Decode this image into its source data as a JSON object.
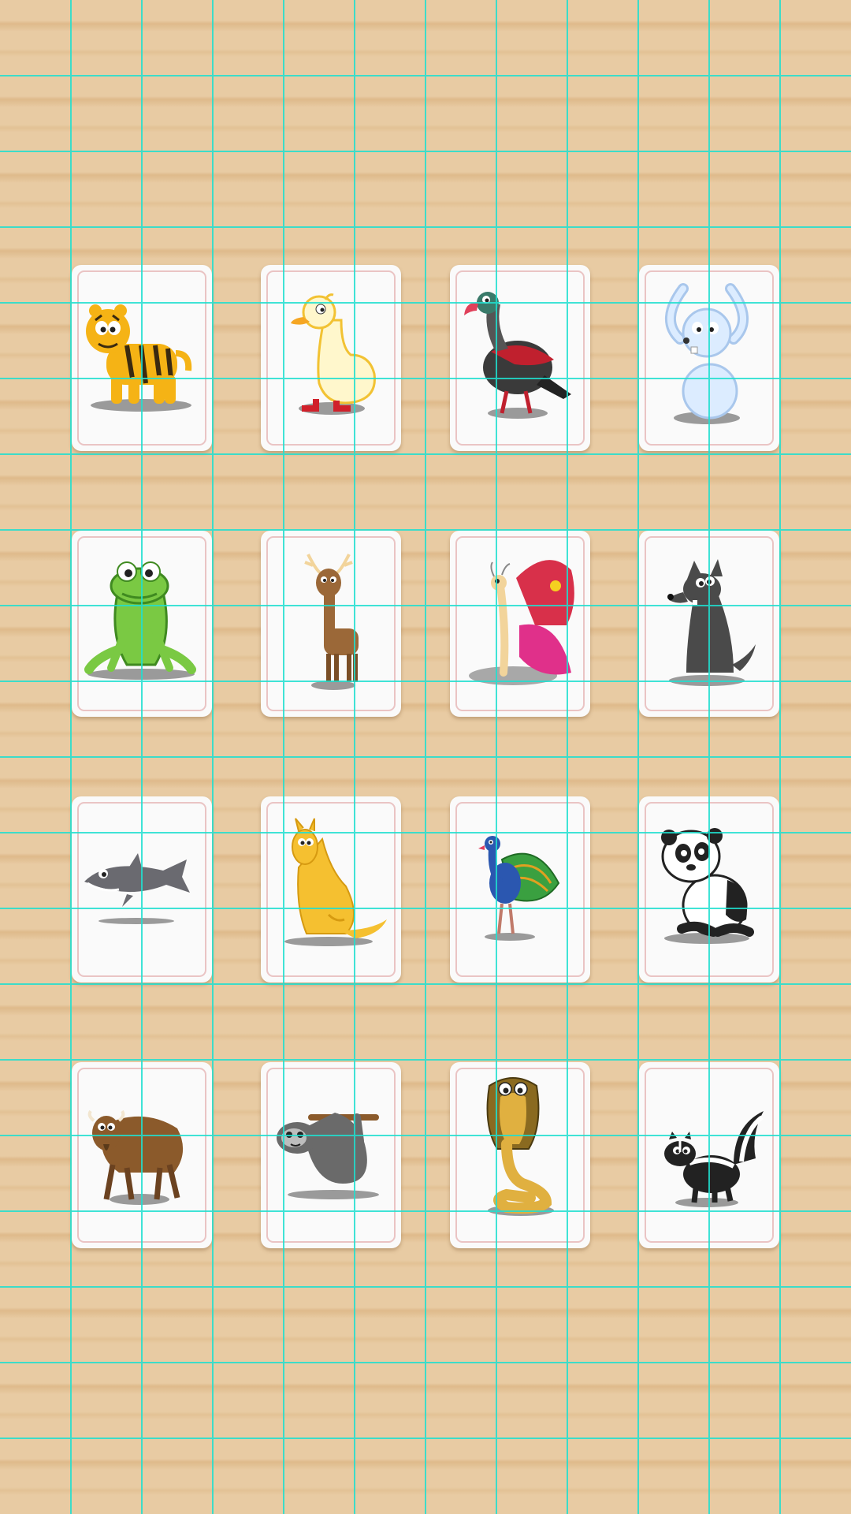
{
  "colors": {
    "table_wood": "#e8cba3",
    "wood_grain": "#d6ac78",
    "card_face": "#fafafa",
    "card_inner_border": "#eac4c4",
    "guide_lines": "#1fe0d0"
  },
  "cards": [
    {
      "animal": "tiger",
      "icon": "tiger-icon"
    },
    {
      "animal": "duck",
      "icon": "duck-icon"
    },
    {
      "animal": "vulture",
      "icon": "vulture-icon"
    },
    {
      "animal": "rabbit",
      "icon": "rabbit-icon"
    },
    {
      "animal": "frog",
      "icon": "frog-icon"
    },
    {
      "animal": "deer",
      "icon": "deer-icon"
    },
    {
      "animal": "butterfly",
      "icon": "butterfly-icon"
    },
    {
      "animal": "wolf",
      "icon": "wolf-icon"
    },
    {
      "animal": "shark",
      "icon": "shark-icon"
    },
    {
      "animal": "kangaroo",
      "icon": "kangaroo-icon"
    },
    {
      "animal": "peacock",
      "icon": "peacock-icon"
    },
    {
      "animal": "panda",
      "icon": "panda-icon"
    },
    {
      "animal": "wildebeest",
      "icon": "wildebeest-icon"
    },
    {
      "animal": "sloth",
      "icon": "sloth-icon"
    },
    {
      "animal": "cobra",
      "icon": "cobra-icon"
    },
    {
      "animal": "skunk",
      "icon": "skunk-icon"
    }
  ]
}
